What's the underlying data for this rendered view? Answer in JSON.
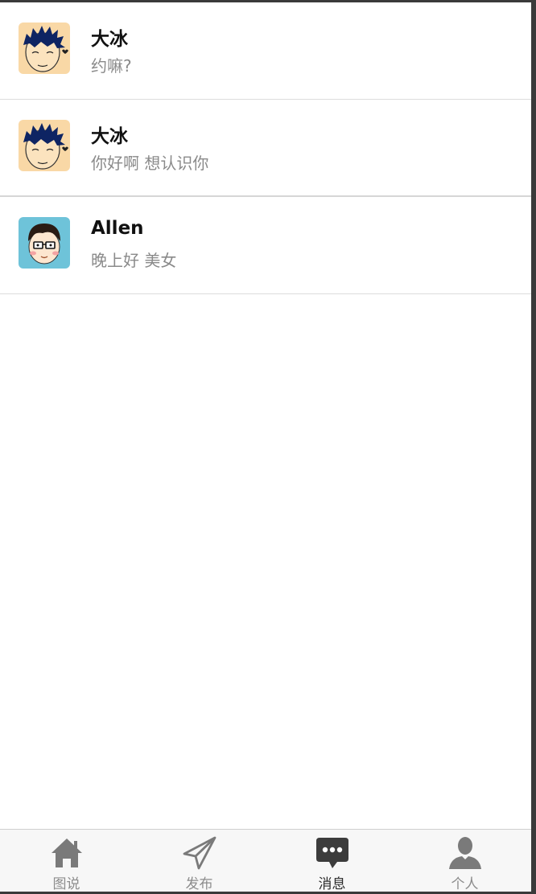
{
  "conversations": [
    {
      "name": "大冰",
      "message": "约嘛?",
      "avatar": "cartoon-boy-spiky-hair-avatar"
    },
    {
      "name": "大冰",
      "message": "你好啊 想认识你",
      "avatar": "cartoon-boy-spiky-hair-avatar"
    },
    {
      "name": "Allen",
      "message": "晚上好 美女",
      "avatar": "cartoon-boy-glasses-avatar"
    }
  ],
  "tabbar": {
    "tabs": [
      {
        "label": "图说",
        "icon": "home-icon",
        "active": false
      },
      {
        "label": "发布",
        "icon": "paper-plane-icon",
        "active": false
      },
      {
        "label": "消息",
        "icon": "chat-bubble-icon",
        "active": true
      },
      {
        "label": "个人",
        "icon": "person-icon",
        "active": false
      }
    ]
  },
  "colors": {
    "background": "#ffffff",
    "name_text": "#111111",
    "message_text": "#8a8a8a",
    "tab_icon": "#7a7a7a",
    "tab_icon_active": "#3c3c3c"
  }
}
